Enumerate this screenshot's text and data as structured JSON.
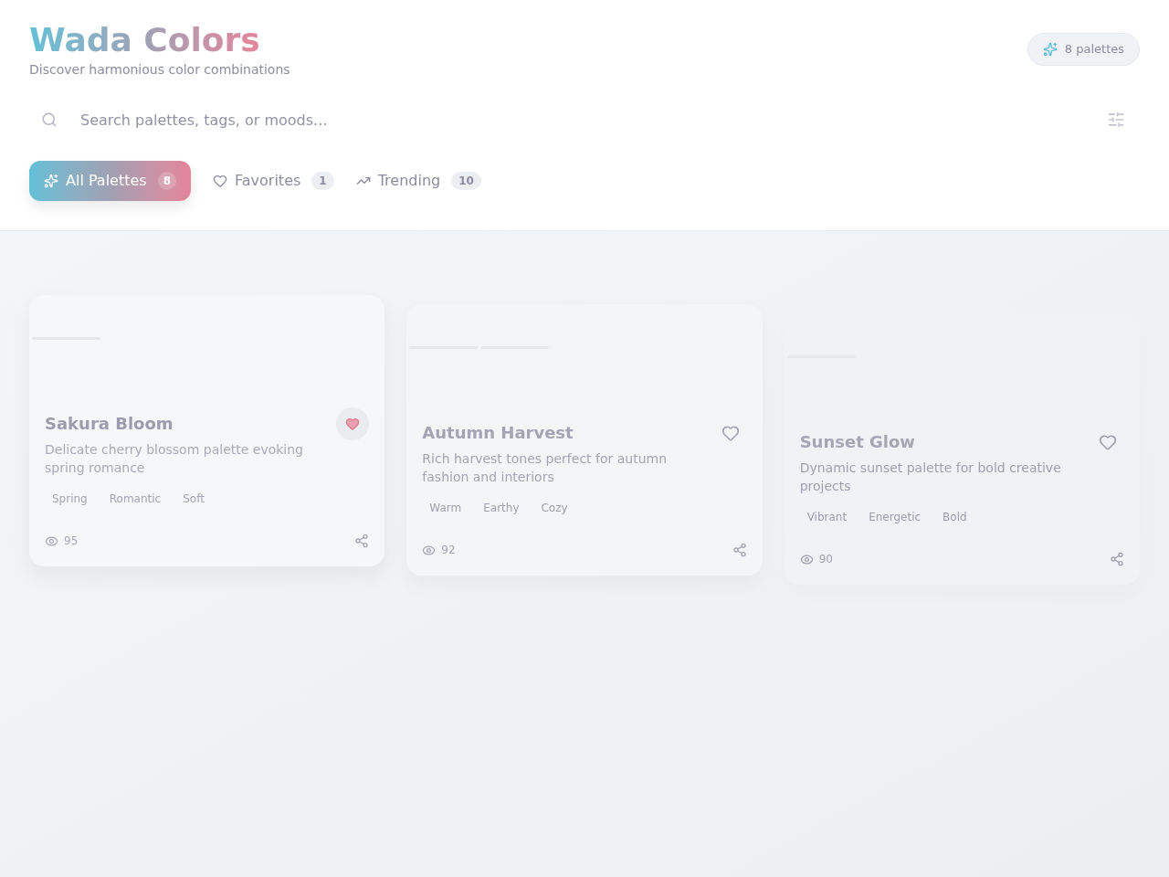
{
  "header": {
    "title": "Wada Colors",
    "subtitle": "Discover harmonious color combinations",
    "count_badge": "8 palettes"
  },
  "search": {
    "placeholder": "Search palettes, tags, or moods..."
  },
  "tabs": [
    {
      "label": "All Palettes",
      "count": "8",
      "selected": true
    },
    {
      "label": "Favorites",
      "count": "1",
      "selected": false
    },
    {
      "label": "Trending",
      "count": "10",
      "selected": false
    }
  ],
  "palettes": [
    {
      "name": "Sakura Bloom",
      "description": "Delicate cherry blossom palette evoking spring romance",
      "tags": [
        "Spring",
        "Romantic",
        "Soft"
      ],
      "views": "95",
      "favorite": true
    },
    {
      "name": "Autumn Harvest",
      "description": "Rich harvest tones perfect for autumn fashion and interiors",
      "tags": [
        "Warm",
        "Earthy",
        "Cozy"
      ],
      "views": "92",
      "favorite": false
    },
    {
      "name": "Sunset Glow",
      "description": "Dynamic sunset palette for bold creative projects",
      "tags": [
        "Vibrant",
        "Energetic",
        "Bold"
      ],
      "views": "90",
      "favorite": false
    }
  ]
}
